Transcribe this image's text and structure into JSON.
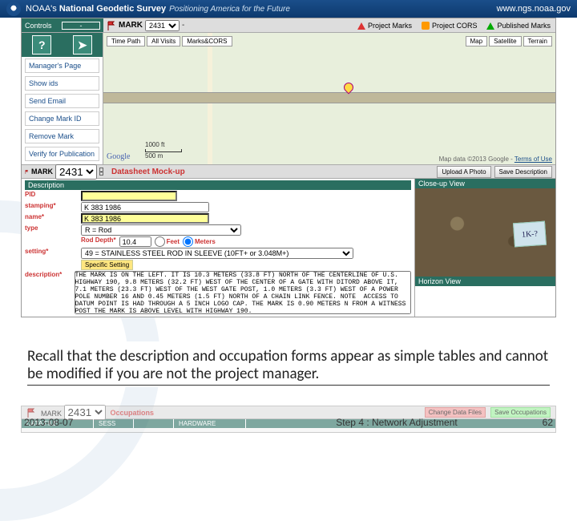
{
  "header": {
    "org": "NOAA's",
    "title": "National Geodetic Survey",
    "tagline": "Positioning America for the Future",
    "url": "www.ngs.noaa.gov"
  },
  "toolbar": {
    "controls": "Controls",
    "mark_label": "MARK",
    "mark_options": [
      "2431"
    ],
    "legend_project": "Project Marks",
    "legend_cors": "Project CORS",
    "legend_published": "Published Marks"
  },
  "sidebar": {
    "items": [
      "Manager's Page",
      "Show ids",
      "Send Email",
      "Change Mark ID",
      "Remove Mark",
      "Verify for Publication"
    ]
  },
  "map": {
    "buttons_left": [
      "Time Path",
      "All Visits",
      "Marks&CORS"
    ],
    "buttons_right": [
      "Map",
      "Satellite",
      "Terrain"
    ],
    "scale_top": "1000 ft",
    "scale_bottom": "500 m",
    "google": "Google",
    "attrib": "Map data ©2013 Google - ",
    "terms": "Terms of Use"
  },
  "datasheet": {
    "mark_label": "MARK",
    "mark_value": "2431",
    "title": "Datasheet Mock-up",
    "btn_upload": "Upload A Photo",
    "btn_save": "Save Description",
    "section": "Description",
    "pid_label": "PID",
    "pid_value": "",
    "stamping_label": "stamping*",
    "stamping_value": "K 383 1986",
    "name_label": "name*",
    "name_value": "K 383 1986",
    "type_label": "type",
    "type_value": "R = Rod",
    "rod_depth_label": "Rod Depth*",
    "rod_depth_value": "10.4",
    "unit_feet": "Feet",
    "unit_meters": "Meters",
    "setting_label": "setting*",
    "setting_value": "49 = STAINLESS STEEL ROD IN SLEEVE (10FT+ or 3.048M+)",
    "specific_label": "Specific Setting",
    "description_label": "description*",
    "description_value": "THE MARK IS ON THE LEFT. IT IS 10.3 METERS (33.8 FT) NORTH OF THE CENTERLINE OF U.S. HIGHWAY 190, 9.8 METERS (32.2 FT) WEST OF THE CENTER OF A GATE WITH DITORD ABOVE IT, 7.1 METERS (23.3 FT) WEST OF THE WEST GATE POST, 1.0 METERS (3.3 FT) WEST OF A POWER POLE NUMBER 16 AND 0.45 METERS (1.5 FT) NORTH OF A CHAIN LINK FENCE. NOTE  ACCESS TO DATUM POINT IS HAD THROUGH A 5 INCH LOGO CAP. THE MARK IS 0.90 METERS N FROM A WITNESS POST THE MARK IS ABOVE LEVEL WITH HIGHWAY 190."
  },
  "right": {
    "closeup": "Close-up View",
    "horizon": "Horizon View",
    "tag": "1K-?"
  },
  "occupations": {
    "title": "Occupations",
    "btn_change": "Change Data Files",
    "btn_save": "Save Occupations",
    "cols": [
      "DATA FILE",
      "SESS",
      "",
      "HARDWARE"
    ]
  },
  "caption": "Recall that the description and occupation forms appear as simple tables and cannot be modified if you are not the project manager.",
  "footer": {
    "date": "2013-08-07",
    "step": "Step 4 : Network Adjustment",
    "page": "62"
  }
}
